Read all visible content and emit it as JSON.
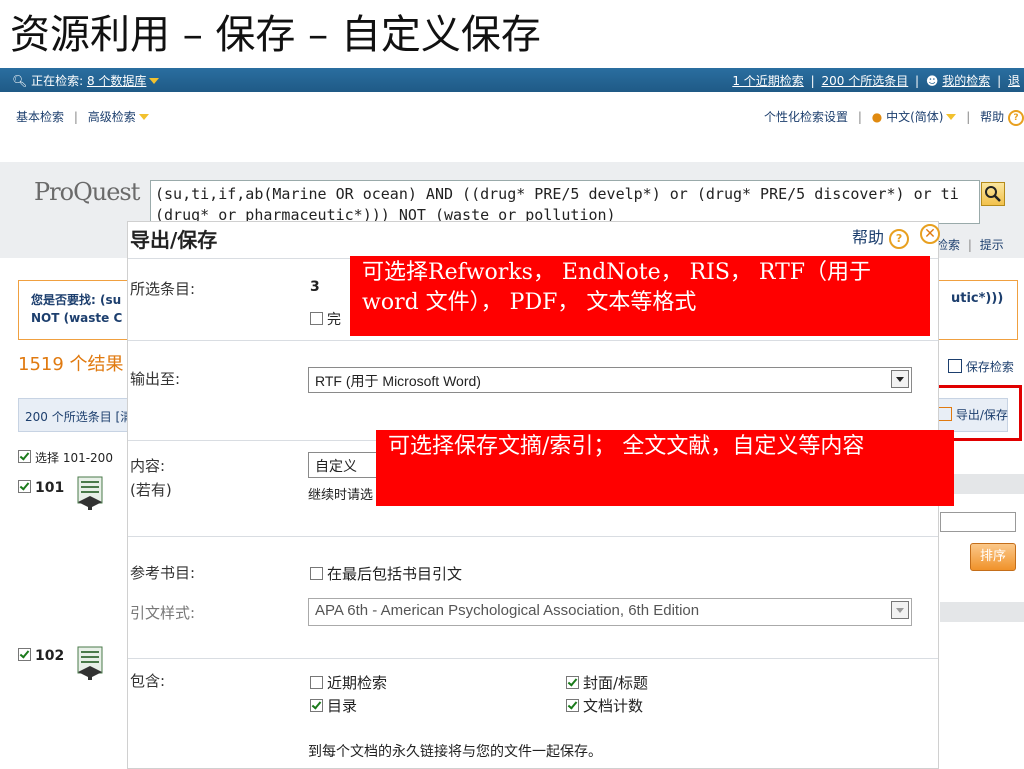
{
  "slide": {
    "title": "资源利用  –  保存  –  自定义保存"
  },
  "topbar": {
    "searching_label": "正在检索:",
    "databases_link": "8 个数据库",
    "recent_searches": "1 个近期检索",
    "selected_items": "200 个所选条目",
    "my_search": "我的检索",
    "cut_tail": "退"
  },
  "nav": {
    "basic_search": "基本检索",
    "advanced_search": "高级检索",
    "preferences": "个性化检索设置",
    "language": "中文(简体)",
    "help": "帮助"
  },
  "search": {
    "logo_text": "ProQuest",
    "query_line1": "(su,ti,if,ab(Marine OR ocean) AND ((drug* PRE/5 develp*) or (drug* PRE/5 discover*) or ti",
    "query_line2": "(drug* or pharmaceutic*))) NOT (waste or pollution)",
    "links_search": "检索",
    "links_tips": "提示"
  },
  "background": {
    "did_you_mean_label": "您是否要找:",
    "did_you_mean_part": "(su",
    "did_you_mean_line2": "NOT (waste C",
    "did_you_mean_right": "utic*)))",
    "results_count": "1519 个结果",
    "save_search": "保存检索",
    "selected_items_bar": "200 个所选条目 [清",
    "export_save": "导出/保存",
    "select_range": "选择 101-200",
    "row1_num": "101",
    "row2_num": "102",
    "sort_button": "排序"
  },
  "dialog": {
    "title": "导出/保存",
    "help_label": "帮助",
    "selected_items_label": "所选条目:",
    "selected_items_value": "3",
    "complete_prefix": "完",
    "output_to_label": "输出至:",
    "output_to_value": "RTF (用于  Microsoft Word)",
    "content_label": "内容:",
    "content_sub_label": "(若有)",
    "content_value": "自定义",
    "content_hint": "继续时请选",
    "bibliography_label": "参考书目:",
    "bibliography_option": "在最后包括书目引文",
    "citation_style_label": "引文样式:",
    "citation_style_value": "APA 6th - American Psychological Association, 6th Edition",
    "include_label": "包含:",
    "include_recent_searches": "近期检索",
    "include_toc": "目录",
    "include_cover": "封面/标题",
    "include_doc_count": "文档计数",
    "permalink_note": "到每个文档的永久链接将与您的文件一起保存。"
  },
  "annotations": {
    "formats": "可选择Refworks， EndNote， RIS， RTF（用于word 文件）， PDF， 文本等格式",
    "content": "可选择保存文摘/索引； 全文文献，自定义等内容"
  },
  "colors": {
    "topbar_blue": "#1f5a86",
    "accent_orange": "#e07a10",
    "callout_red": "#ff0000",
    "link_blue": "#1d3f6e"
  }
}
